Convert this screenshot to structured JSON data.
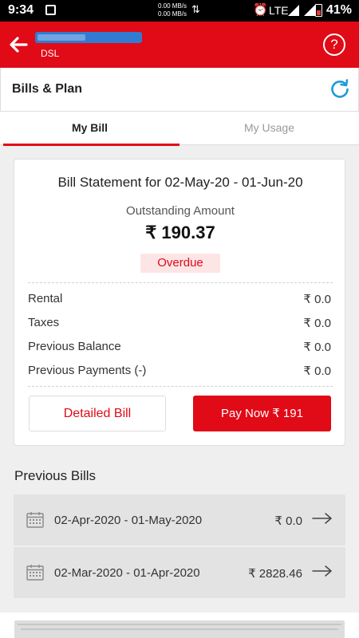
{
  "status_bar": {
    "time": "9:34",
    "speed_up": "0.00 MB/s",
    "speed_down": "0.00 MB/s",
    "network": "LTE",
    "battery": "41%",
    "icons": [
      "app-notification-icon",
      "data-arrows-icon",
      "alarm-icon",
      "signal-icon",
      "battery-icon"
    ]
  },
  "app_bar": {
    "subtitle": "DSL",
    "help_label": "?",
    "bg_color": "#e10a17"
  },
  "section": {
    "title": "Bills & Plan"
  },
  "tabs": [
    {
      "label": "My Bill",
      "active": true
    },
    {
      "label": "My Usage",
      "active": false
    }
  ],
  "bill": {
    "statement": "Bill Statement for 02-May-20 - 01-Jun-20",
    "outstanding_label": "Outstanding Amount",
    "outstanding_amount": "₹ 190.37",
    "status": "Overdue",
    "rows": [
      {
        "label": "Rental",
        "value": "₹ 0.0"
      },
      {
        "label": "Taxes",
        "value": "₹ 0.0"
      },
      {
        "label": "Previous Balance",
        "value": "₹ 0.0"
      },
      {
        "label": "Previous Payments (-)",
        "value": "₹ 0.0"
      }
    ],
    "detailed_button": "Detailed Bill",
    "pay_button": "Pay Now ₹ 191"
  },
  "previous_bills": {
    "heading": "Previous Bills",
    "items": [
      {
        "dates": "02-Apr-2020 - 01-May-2020",
        "amount": "₹ 0.0"
      },
      {
        "dates": "02-Mar-2020 - 01-Apr-2020",
        "amount": "₹ 2828.46"
      }
    ]
  },
  "colors": {
    "accent": "#e10a17",
    "refresh": "#1e9bd7"
  }
}
